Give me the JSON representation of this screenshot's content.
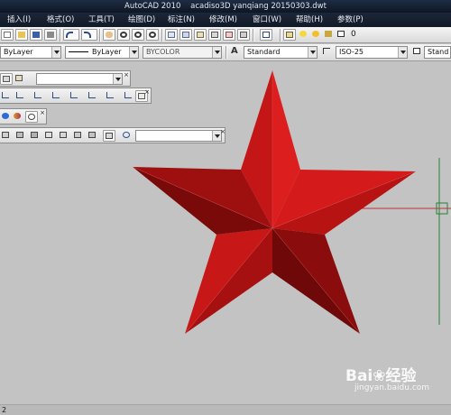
{
  "window": {
    "app_title": "AutoCAD 2010",
    "file_title": "acadiso3D  yanqiang 20150303.dwt"
  },
  "menu": {
    "items": [
      {
        "label": "插入(I)"
      },
      {
        "label": "格式(O)"
      },
      {
        "label": "工具(T)"
      },
      {
        "label": "绘图(D)"
      },
      {
        "label": "标注(N)"
      },
      {
        "label": "修改(M)"
      },
      {
        "label": "窗口(W)"
      },
      {
        "label": "帮助(H)"
      },
      {
        "label": "参数(P)"
      }
    ]
  },
  "layer_toolbar": {
    "layer_value": "0"
  },
  "properties_toolbar": {
    "color_value": "ByLayer",
    "linetype_value": "ByLayer",
    "lineweight_value": "BYCOLOR"
  },
  "styles_toolbar": {
    "text_style_value": "Standard",
    "dim_style_value": "ISO-25",
    "table_style_value": "Stand"
  },
  "bottom_bar": {
    "tab_label": "2"
  },
  "watermark": {
    "brand": "Bai",
    "brand_suffix": "经验",
    "url": "jingyan.baidu.com"
  },
  "colors": {
    "star_face_light": "#d01818",
    "star_face_dark": "#7a0a0a",
    "canvas_bg": "#c3c3c3"
  },
  "icons": {
    "save": "save-icon",
    "undo": "undo-icon",
    "redo": "redo-icon",
    "pan": "pan-icon",
    "zoom": "zoom-icon",
    "properties": "properties-icon",
    "help": "help-icon",
    "layer_bulb": "lightbulb-icon",
    "text_style": "text-style-icon",
    "dim_style": "dimension-style-icon",
    "ucs": "ucs-icon"
  }
}
